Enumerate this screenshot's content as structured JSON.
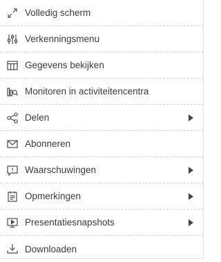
{
  "menu": {
    "items": [
      {
        "label": "Volledig scherm",
        "icon": "fullscreen-icon",
        "submenu": false
      },
      {
        "label": "Verkenningsmenu",
        "icon": "sliders-icon",
        "submenu": false
      },
      {
        "label": "Gegevens bekijken",
        "icon": "table-icon",
        "submenu": false
      },
      {
        "label": "Monitoren in activiteitencentra",
        "icon": "monitor-chart-icon",
        "submenu": false
      },
      {
        "label": "Delen",
        "icon": "share-icon",
        "submenu": true
      },
      {
        "label": "Abonneren",
        "icon": "envelope-icon",
        "submenu": false
      },
      {
        "label": "Waarschuwingen",
        "icon": "alert-icon",
        "submenu": true
      },
      {
        "label": "Opmerkingen",
        "icon": "notes-icon",
        "submenu": true
      },
      {
        "label": "Presentatiesnapshots",
        "icon": "presentation-icon",
        "submenu": true
      },
      {
        "label": "Downloaden",
        "icon": "download-icon",
        "submenu": false
      }
    ]
  }
}
